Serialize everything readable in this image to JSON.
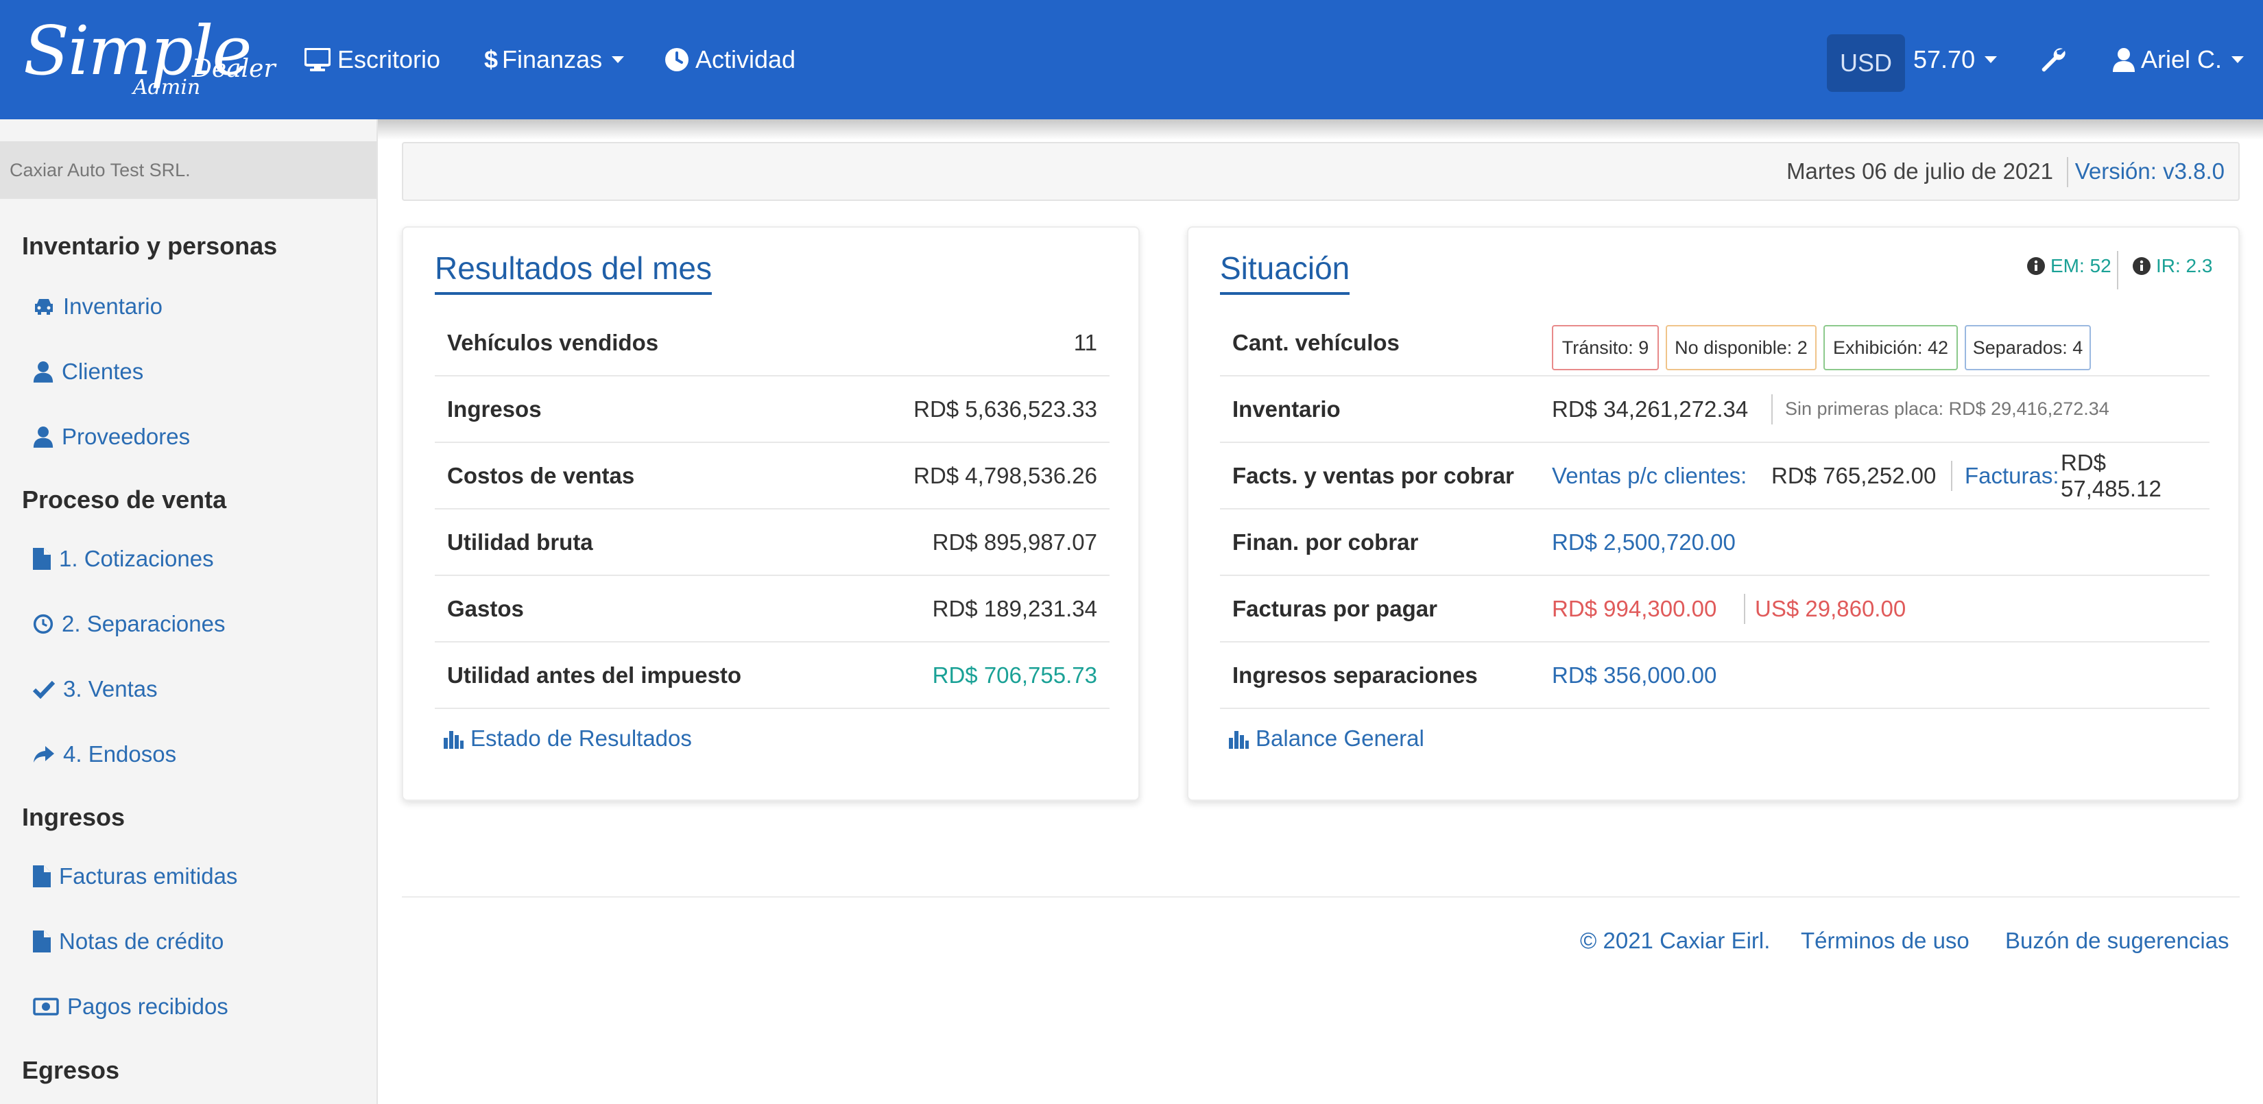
{
  "brand": {
    "simple": "Simple",
    "dealer": "Dealer",
    "admin": "Admin"
  },
  "nav": {
    "escritorio": "Escritorio",
    "finanzas": "Finanzas",
    "actividad": "Actividad",
    "currency": "USD",
    "rate": "57.70",
    "user": "Ariel C."
  },
  "sidebar": {
    "company": "Caxiar Auto Test SRL.",
    "sections": {
      "inventario": "Inventario y personas",
      "proceso": "Proceso de venta",
      "ingresos": "Ingresos",
      "egresos": "Egresos"
    },
    "items": {
      "inventario": "Inventario",
      "clientes": "Clientes",
      "proveedores": "Proveedores",
      "cotizaciones": "1. Cotizaciones",
      "separaciones": "2. Separaciones",
      "ventas": "3. Ventas",
      "endosos": "4. Endosos",
      "facturas": "Facturas emitidas",
      "notas": "Notas de crédito",
      "pagos": "Pagos recibidos"
    }
  },
  "datebar": {
    "date": "Martes 06 de julio de 2021",
    "version": "Versión: v3.8.0"
  },
  "resultados": {
    "title": "Resultados del mes",
    "rows": [
      {
        "label": "Vehículos vendidos",
        "value": "11"
      },
      {
        "label": "Ingresos",
        "value": "RD$ 5,636,523.33"
      },
      {
        "label": "Costos de ventas",
        "value": "RD$ 4,798,536.26"
      },
      {
        "label": "Utilidad bruta",
        "value": "RD$ 895,987.07"
      },
      {
        "label": "Gastos",
        "value": "RD$ 189,231.34"
      },
      {
        "label": "Utilidad antes del impuesto",
        "value": "RD$ 706,755.73"
      }
    ],
    "link": "Estado de Resultados"
  },
  "situacion": {
    "title": "Situación",
    "em": "EM: 52",
    "ir": "IR: 2.3",
    "cant_label": "Cant. vehículos",
    "badges": {
      "transito": "Tránsito: 9",
      "no_disponible": "No disponible: 2",
      "exhibicion": "Exhibición: 42",
      "separados": "Separados: 4"
    },
    "inventario_label": "Inventario",
    "inventario_value": "RD$ 34,261,272.34",
    "inventario_sub": "Sin primeras placa: RD$ 29,416,272.34",
    "facts_label": "Facts. y ventas por cobrar",
    "ventas_pc_label": "Ventas p/c clientes:",
    "ventas_pc_value": "RD$ 765,252.00",
    "facturas_label": "Facturas:",
    "facturas_value": "RD$ 57,485.12",
    "finan_label": "Finan. por cobrar",
    "finan_value": "RD$ 2,500,720.00",
    "fpp_label": "Facturas por pagar",
    "fpp_rd": "RD$ 994,300.00",
    "fpp_us": "US$ 29,860.00",
    "ing_sep_label": "Ingresos separaciones",
    "ing_sep_value": "RD$ 356,000.00",
    "link": "Balance General"
  },
  "footer": {
    "copyright": "© 2021 Caxiar Eirl.",
    "terms": "Términos de uso",
    "suggestions": "Buzón de sugerencias"
  },
  "colors": {
    "navbar": "#2264c8",
    "link": "#2a6cb3",
    "positive": "#1aa196",
    "negative": "#e05a5a",
    "badge_transito": "#e88a8a",
    "badge_no_disponible": "#f0c48a",
    "badge_exhibicion": "#8cc98c",
    "badge_separados": "#9ab8e0"
  }
}
